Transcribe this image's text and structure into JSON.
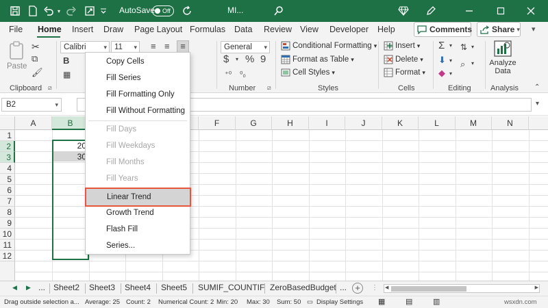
{
  "app": {
    "autosave_label": "AutoSave",
    "autosave_state": "Off",
    "doc_title": "MI...",
    "accent_color": "#1e7145"
  },
  "ribbon_tabs": [
    "File",
    "Home",
    "Insert",
    "Draw",
    "Page Layout",
    "Formulas",
    "Data",
    "Review",
    "View",
    "Developer",
    "Help"
  ],
  "active_tab": "Home",
  "comments_label": "Comments",
  "share_label": "Share",
  "ribbon": {
    "clipboard": {
      "paste_label": "Paste",
      "group_label": "Clipboard"
    },
    "font": {
      "name": "Calibri",
      "size": "11",
      "bold": "B"
    },
    "number": {
      "format": "General",
      "currency": "$",
      "percent": "%",
      "comma": "9",
      "group_label": "Number"
    },
    "styles": {
      "conditional": "Conditional Formatting",
      "format_table": "Format as Table",
      "cell_styles": "Cell Styles",
      "group_label": "Styles"
    },
    "cells": {
      "insert": "Insert",
      "delete": "Delete",
      "format": "Format",
      "group_label": "Cells"
    },
    "editing": {
      "group_label": "Editing"
    },
    "analysis": {
      "analyze_line1": "Analyze",
      "analyze_line2": "Data",
      "group_label": "Analysis"
    }
  },
  "formula_bar": {
    "name_box": "B2",
    "formula": ""
  },
  "grid": {
    "columns": [
      "A",
      "B",
      "C",
      "D",
      "E",
      "F",
      "G",
      "H",
      "I",
      "J",
      "K",
      "L",
      "M",
      "N"
    ],
    "rows": [
      "1",
      "2",
      "3",
      "4",
      "5",
      "6",
      "7",
      "8",
      "9",
      "10",
      "11",
      "12"
    ],
    "selected_column": "B",
    "cells": {
      "B2": "20",
      "B3": "30"
    }
  },
  "context_menu": {
    "items": [
      {
        "label": "Copy Cells",
        "disabled": false
      },
      {
        "label": "Fill Series",
        "disabled": false
      },
      {
        "label": "Fill Formatting Only",
        "disabled": false
      },
      {
        "label": "Fill Without Formatting",
        "disabled": false
      },
      {
        "label": "Fill Days",
        "disabled": true
      },
      {
        "label": "Fill Weekdays",
        "disabled": true
      },
      {
        "label": "Fill Months",
        "disabled": true
      },
      {
        "label": "Fill Years",
        "disabled": true
      },
      {
        "label": "Linear Trend",
        "disabled": false,
        "highlighted": true
      },
      {
        "label": "Growth Trend",
        "disabled": false
      },
      {
        "label": "Flash Fill",
        "disabled": false
      },
      {
        "label": "Series...",
        "disabled": false
      }
    ]
  },
  "sheet_tabs": {
    "ellipsis_left": "...",
    "sheets": [
      "Sheet2",
      "Sheet3",
      "Sheet4",
      "Sheet5",
      "SUMIF_COUNTIF",
      "ZeroBasedBudget"
    ],
    "ellipsis_right": "...",
    "add_label": "+"
  },
  "status_bar": {
    "message": "Drag outside selection a...",
    "average": "Average: 25",
    "count": "Count: 2",
    "numerical_count": "Numerical Count: 2",
    "min": "Min: 20",
    "max": "Max: 30",
    "sum": "Sum: 50",
    "display_settings": "Display Settings"
  },
  "watermark": "wsxdn.com"
}
